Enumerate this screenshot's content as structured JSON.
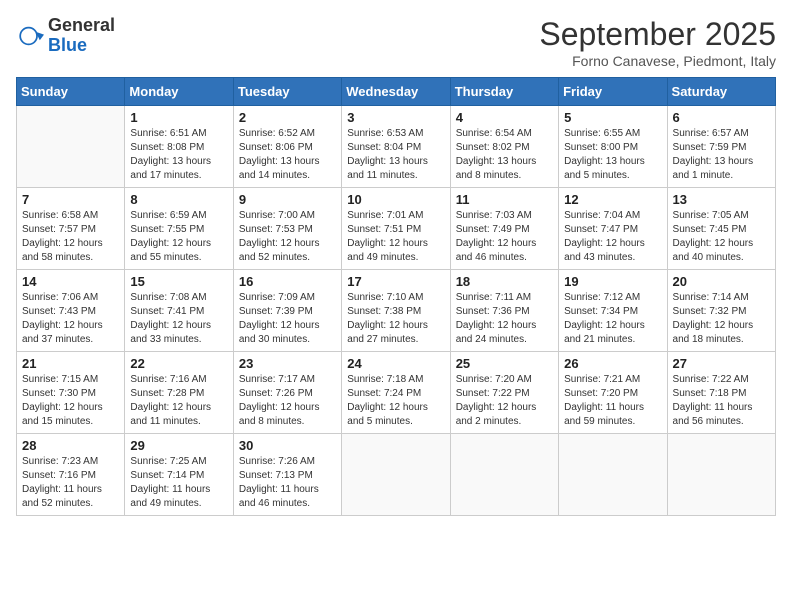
{
  "header": {
    "logo_general": "General",
    "logo_blue": "Blue",
    "month_title": "September 2025",
    "location": "Forno Canavese, Piedmont, Italy"
  },
  "weekdays": [
    "Sunday",
    "Monday",
    "Tuesday",
    "Wednesday",
    "Thursday",
    "Friday",
    "Saturday"
  ],
  "weeks": [
    [
      {
        "day": "",
        "empty": true
      },
      {
        "day": "1",
        "sunrise": "6:51 AM",
        "sunset": "8:08 PM",
        "daylight": "13 hours and 17 minutes."
      },
      {
        "day": "2",
        "sunrise": "6:52 AM",
        "sunset": "8:06 PM",
        "daylight": "13 hours and 14 minutes."
      },
      {
        "day": "3",
        "sunrise": "6:53 AM",
        "sunset": "8:04 PM",
        "daylight": "13 hours and 11 minutes."
      },
      {
        "day": "4",
        "sunrise": "6:54 AM",
        "sunset": "8:02 PM",
        "daylight": "13 hours and 8 minutes."
      },
      {
        "day": "5",
        "sunrise": "6:55 AM",
        "sunset": "8:00 PM",
        "daylight": "13 hours and 5 minutes."
      },
      {
        "day": "6",
        "sunrise": "6:57 AM",
        "sunset": "7:59 PM",
        "daylight": "13 hours and 1 minute."
      }
    ],
    [
      {
        "day": "7",
        "sunrise": "6:58 AM",
        "sunset": "7:57 PM",
        "daylight": "12 hours and 58 minutes."
      },
      {
        "day": "8",
        "sunrise": "6:59 AM",
        "sunset": "7:55 PM",
        "daylight": "12 hours and 55 minutes."
      },
      {
        "day": "9",
        "sunrise": "7:00 AM",
        "sunset": "7:53 PM",
        "daylight": "12 hours and 52 minutes."
      },
      {
        "day": "10",
        "sunrise": "7:01 AM",
        "sunset": "7:51 PM",
        "daylight": "12 hours and 49 minutes."
      },
      {
        "day": "11",
        "sunrise": "7:03 AM",
        "sunset": "7:49 PM",
        "daylight": "12 hours and 46 minutes."
      },
      {
        "day": "12",
        "sunrise": "7:04 AM",
        "sunset": "7:47 PM",
        "daylight": "12 hours and 43 minutes."
      },
      {
        "day": "13",
        "sunrise": "7:05 AM",
        "sunset": "7:45 PM",
        "daylight": "12 hours and 40 minutes."
      }
    ],
    [
      {
        "day": "14",
        "sunrise": "7:06 AM",
        "sunset": "7:43 PM",
        "daylight": "12 hours and 37 minutes."
      },
      {
        "day": "15",
        "sunrise": "7:08 AM",
        "sunset": "7:41 PM",
        "daylight": "12 hours and 33 minutes."
      },
      {
        "day": "16",
        "sunrise": "7:09 AM",
        "sunset": "7:39 PM",
        "daylight": "12 hours and 30 minutes."
      },
      {
        "day": "17",
        "sunrise": "7:10 AM",
        "sunset": "7:38 PM",
        "daylight": "12 hours and 27 minutes."
      },
      {
        "day": "18",
        "sunrise": "7:11 AM",
        "sunset": "7:36 PM",
        "daylight": "12 hours and 24 minutes."
      },
      {
        "day": "19",
        "sunrise": "7:12 AM",
        "sunset": "7:34 PM",
        "daylight": "12 hours and 21 minutes."
      },
      {
        "day": "20",
        "sunrise": "7:14 AM",
        "sunset": "7:32 PM",
        "daylight": "12 hours and 18 minutes."
      }
    ],
    [
      {
        "day": "21",
        "sunrise": "7:15 AM",
        "sunset": "7:30 PM",
        "daylight": "12 hours and 15 minutes."
      },
      {
        "day": "22",
        "sunrise": "7:16 AM",
        "sunset": "7:28 PM",
        "daylight": "12 hours and 11 minutes."
      },
      {
        "day": "23",
        "sunrise": "7:17 AM",
        "sunset": "7:26 PM",
        "daylight": "12 hours and 8 minutes."
      },
      {
        "day": "24",
        "sunrise": "7:18 AM",
        "sunset": "7:24 PM",
        "daylight": "12 hours and 5 minutes."
      },
      {
        "day": "25",
        "sunrise": "7:20 AM",
        "sunset": "7:22 PM",
        "daylight": "12 hours and 2 minutes."
      },
      {
        "day": "26",
        "sunrise": "7:21 AM",
        "sunset": "7:20 PM",
        "daylight": "11 hours and 59 minutes."
      },
      {
        "day": "27",
        "sunrise": "7:22 AM",
        "sunset": "7:18 PM",
        "daylight": "11 hours and 56 minutes."
      }
    ],
    [
      {
        "day": "28",
        "sunrise": "7:23 AM",
        "sunset": "7:16 PM",
        "daylight": "11 hours and 52 minutes."
      },
      {
        "day": "29",
        "sunrise": "7:25 AM",
        "sunset": "7:14 PM",
        "daylight": "11 hours and 49 minutes."
      },
      {
        "day": "30",
        "sunrise": "7:26 AM",
        "sunset": "7:13 PM",
        "daylight": "11 hours and 46 minutes."
      },
      {
        "day": "",
        "empty": true
      },
      {
        "day": "",
        "empty": true
      },
      {
        "day": "",
        "empty": true
      },
      {
        "day": "",
        "empty": true
      }
    ]
  ]
}
